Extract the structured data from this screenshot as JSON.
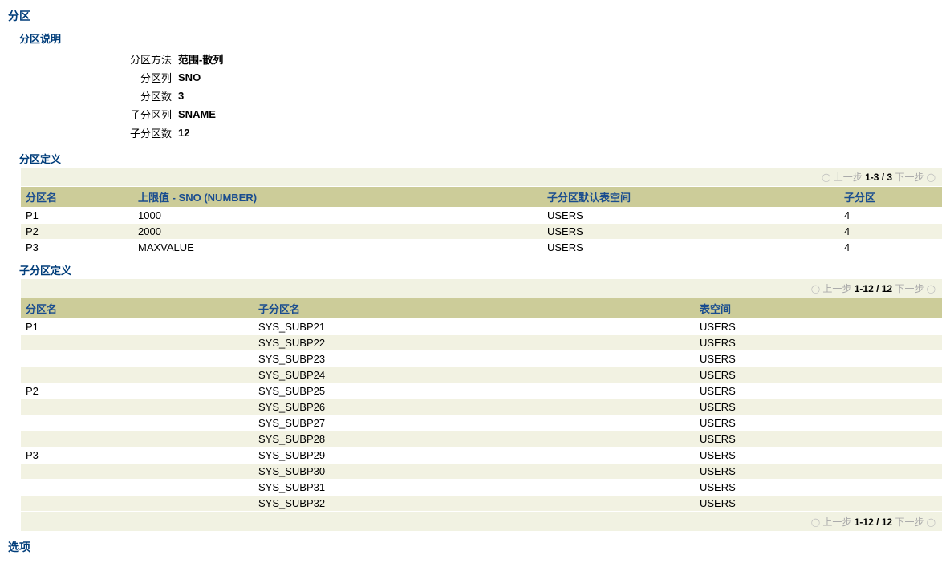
{
  "titles": {
    "main": "分区",
    "desc": "分区说明",
    "def1": "分区定义",
    "def2": "子分区定义",
    "options": "选项"
  },
  "desc": {
    "method_label": "分区方法",
    "method_value": "范围-散列",
    "col_label": "分区列",
    "col_value": "SNO",
    "count_label": "分区数",
    "count_value": "3",
    "subcol_label": "子分区列",
    "subcol_value": "SNAME",
    "subcount_label": "子分区数",
    "subcount_value": "12"
  },
  "pager": {
    "prev": "上一步",
    "next": "下一步",
    "range1": "1-3 / 3",
    "range2": "1-12 / 12"
  },
  "grid1": {
    "h1": "分区名",
    "h2": "上限值 - SNO (NUMBER)",
    "h3": "子分区默认表空间",
    "h4": "子分区",
    "rows": [
      {
        "name": "P1",
        "upper": "1000",
        "ts": "USERS",
        "sub": "4"
      },
      {
        "name": "P2",
        "upper": "2000",
        "ts": "USERS",
        "sub": "4"
      },
      {
        "name": "P3",
        "upper": "MAXVALUE",
        "ts": "USERS",
        "sub": "4"
      }
    ]
  },
  "grid2": {
    "h1": "分区名",
    "h2": "子分区名",
    "h3": "表空间",
    "rows": [
      {
        "p": "P1",
        "sp": "SYS_SUBP21",
        "ts": "USERS"
      },
      {
        "p": "",
        "sp": "SYS_SUBP22",
        "ts": "USERS"
      },
      {
        "p": "",
        "sp": "SYS_SUBP23",
        "ts": "USERS"
      },
      {
        "p": "",
        "sp": "SYS_SUBP24",
        "ts": "USERS"
      },
      {
        "p": "P2",
        "sp": "SYS_SUBP25",
        "ts": "USERS"
      },
      {
        "p": "",
        "sp": "SYS_SUBP26",
        "ts": "USERS"
      },
      {
        "p": "",
        "sp": "SYS_SUBP27",
        "ts": "USERS"
      },
      {
        "p": "",
        "sp": "SYS_SUBP28",
        "ts": "USERS"
      },
      {
        "p": "P3",
        "sp": "SYS_SUBP29",
        "ts": "USERS"
      },
      {
        "p": "",
        "sp": "SYS_SUBP30",
        "ts": "USERS"
      },
      {
        "p": "",
        "sp": "SYS_SUBP31",
        "ts": "USERS"
      },
      {
        "p": "",
        "sp": "SYS_SUBP32",
        "ts": "USERS"
      }
    ]
  }
}
